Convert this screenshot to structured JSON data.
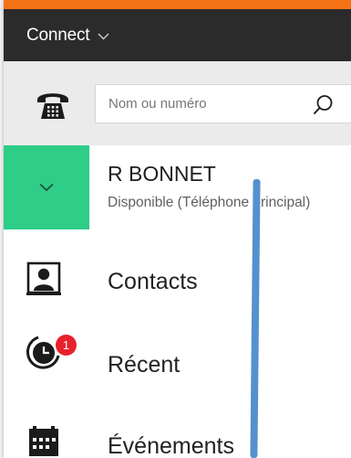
{
  "app": {
    "title": "Connect"
  },
  "search": {
    "placeholder": "Nom ou numéro"
  },
  "user": {
    "name": "R BONNET",
    "status": "Disponible (Téléphone principal)"
  },
  "nav": {
    "items": [
      {
        "label": "Contacts",
        "icon": "contact-card-icon"
      },
      {
        "label": "Récent",
        "icon": "clock-icon",
        "badge": "1"
      },
      {
        "label": "Événements",
        "icon": "calendar-icon"
      }
    ]
  },
  "colors": {
    "accent_orange": "#f47216",
    "titlebar": "#2b2b2b",
    "presence_green": "#2ecd88",
    "badge_red": "#e8212c",
    "annotation_blue": "#5591ce"
  }
}
